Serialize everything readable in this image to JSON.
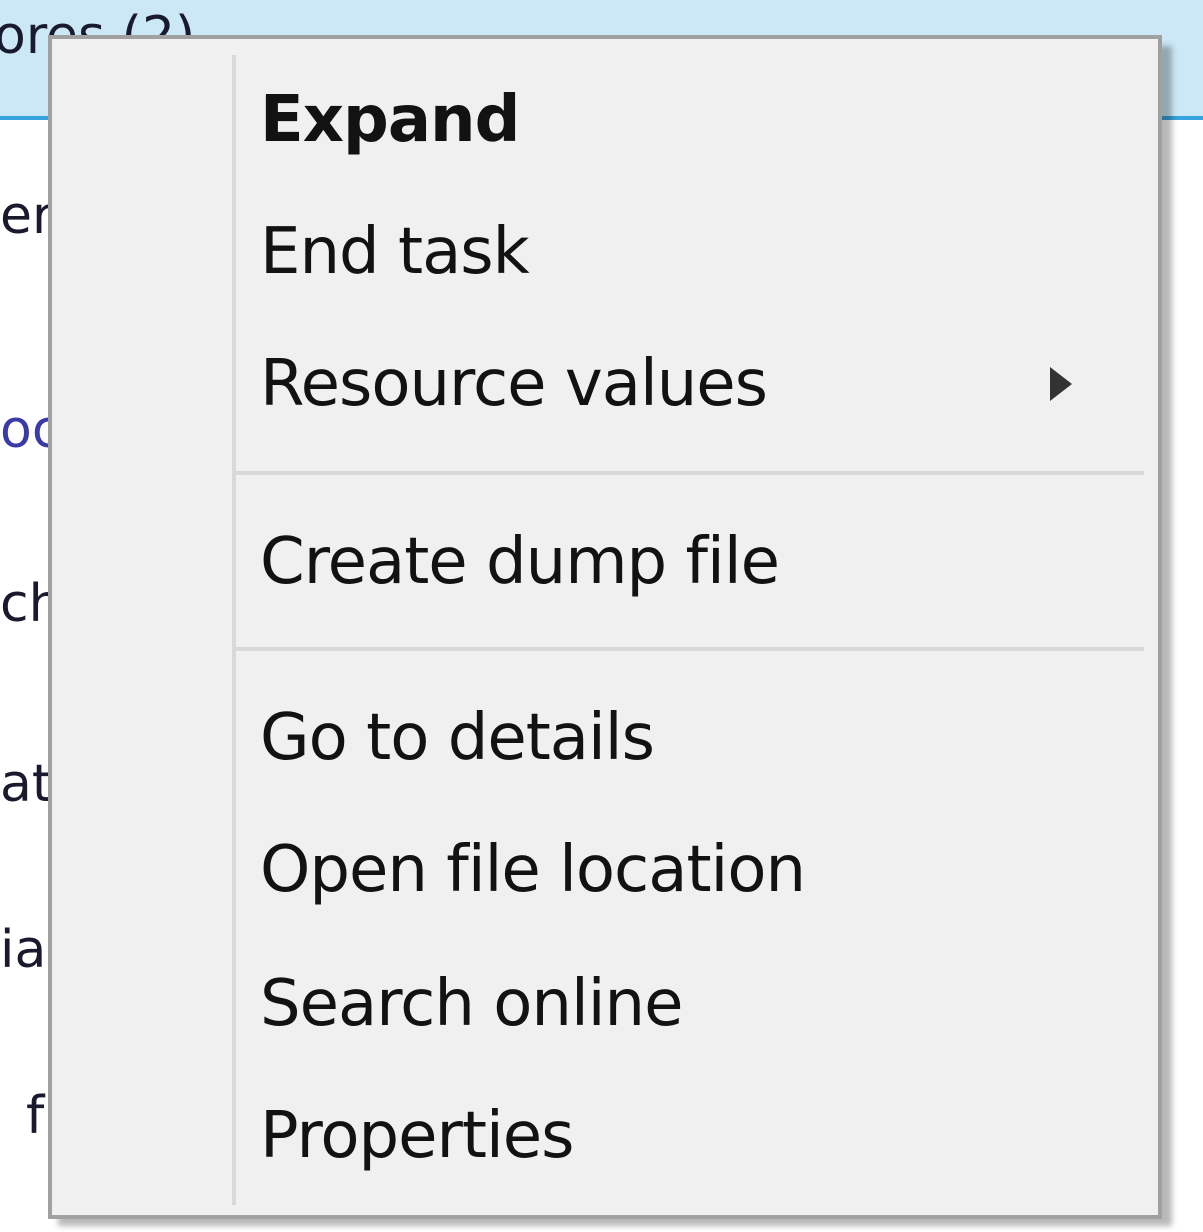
{
  "background": {
    "selected_row_text": "ores (2)",
    "row_fragments": [
      "er",
      "oc",
      "ch",
      "at",
      "ia",
      "f"
    ]
  },
  "context_menu": {
    "items": [
      {
        "label": "Expand",
        "bold": true
      },
      {
        "label": "End task"
      },
      {
        "label": "Resource values",
        "has_submenu": true
      },
      {
        "label": "Create dump file"
      },
      {
        "label": "Go to details"
      },
      {
        "label": "Open file location"
      },
      {
        "label": "Search online"
      },
      {
        "label": "Properties"
      }
    ]
  },
  "colors": {
    "menu_background": "#f0f0f0",
    "menu_border": "#a0a0a0",
    "selection_highlight": "#cce8f6",
    "selection_border": "#36a3dc"
  }
}
